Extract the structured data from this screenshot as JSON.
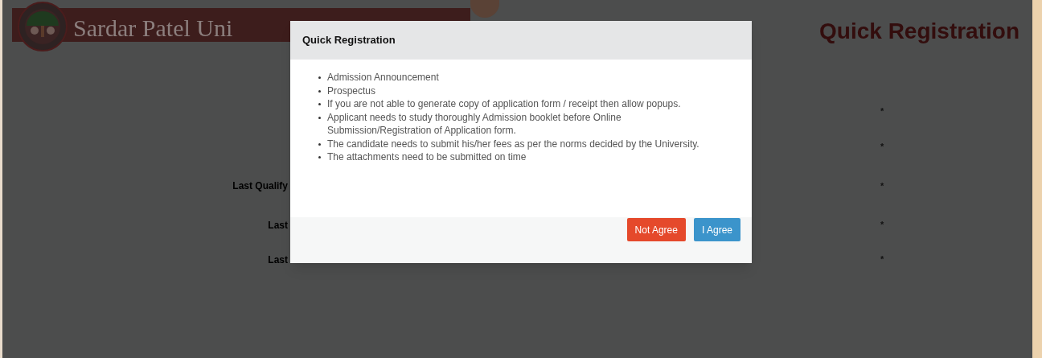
{
  "header": {
    "title": "Sardar Patel Uni",
    "page_heading": "Quick Registration"
  },
  "form_rows": [
    {
      "label": "",
      "required_mark": "*"
    },
    {
      "label": "",
      "required_mark": "*"
    },
    {
      "label": "Last Qualify",
      "required_mark": "*"
    },
    {
      "label": "Last",
      "required_mark": "*"
    },
    {
      "label": "Last",
      "required_mark": "*"
    }
  ],
  "dialog": {
    "title": "Quick Registration",
    "items": [
      "Admission Announcement",
      "Prospectus",
      "If you are not able to generate copy of application form / receipt then allow popups.",
      "Applicant needs to study thoroughly Admission booklet before Online Submission/Registration of Application form.",
      "The candidate needs to submit his/her fees as per the norms decided by the University.",
      "The attachments need to be submitted on time"
    ],
    "buttons": [
      {
        "label": "Not Agree",
        "kind": "danger"
      },
      {
        "label": "I Agree",
        "kind": "primary"
      }
    ]
  }
}
